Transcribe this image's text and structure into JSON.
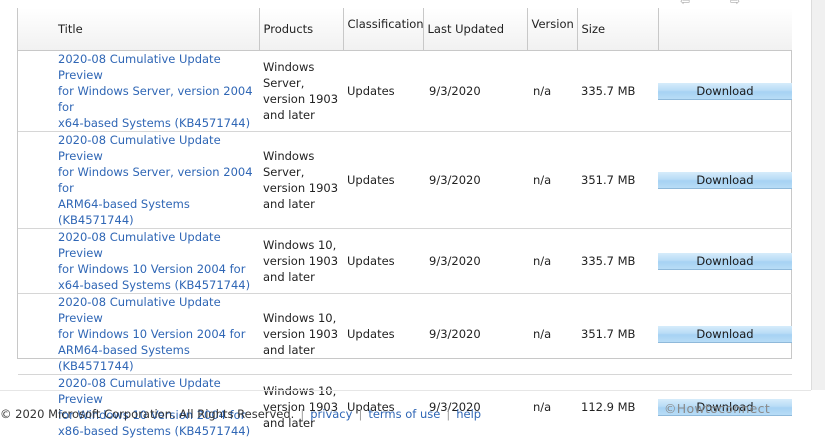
{
  "table": {
    "headers": {
      "title": "Title",
      "products": "Products",
      "classification": "Classification",
      "last_updated": "Last Updated",
      "version": "Version",
      "size": "Size"
    },
    "rows": [
      {
        "title": [
          "2020-08 Cumulative Update Preview",
          "for Windows Server, version 2004 for",
          "x64-based Systems (KB4571744)"
        ],
        "products": [
          "Windows",
          "Server,",
          "version 1903",
          "and later"
        ],
        "classification": "Updates",
        "last_updated": "9/3/2020",
        "version": "n/a",
        "size": "335.7 MB",
        "download": "Download"
      },
      {
        "title": [
          "2020-08 Cumulative Update Preview",
          "for Windows Server, version 2004 for",
          "ARM64-based Systems (KB4571744)"
        ],
        "products": [
          "Windows",
          "Server,",
          "version 1903",
          "and later"
        ],
        "classification": "Updates",
        "last_updated": "9/3/2020",
        "version": "n/a",
        "size": "351.7 MB",
        "download": "Download"
      },
      {
        "title": [
          "2020-08 Cumulative Update Preview",
          "for Windows 10 Version 2004 for",
          "x64-based Systems (KB4571744)"
        ],
        "products": [
          "Windows 10,",
          "version 1903",
          "and later"
        ],
        "classification": "Updates",
        "last_updated": "9/3/2020",
        "version": "n/a",
        "size": "335.7 MB",
        "download": "Download"
      },
      {
        "title": [
          "2020-08 Cumulative Update Preview",
          "for Windows 10 Version 2004 for",
          "ARM64-based Systems (KB4571744)"
        ],
        "products": [
          "Windows 10,",
          "version 1903",
          "and later"
        ],
        "classification": "Updates",
        "last_updated": "9/3/2020",
        "version": "n/a",
        "size": "351.7 MB",
        "download": "Download"
      },
      {
        "title": [
          "2020-08 Cumulative Update Preview",
          "for Windows 10 Version 2004 for",
          "x86-based Systems (KB4571744)"
        ],
        "products": [
          "Windows 10,",
          "version 1903",
          "and later"
        ],
        "classification": "Updates",
        "last_updated": "9/3/2020",
        "version": "n/a",
        "size": "112.9 MB",
        "download": "Download"
      }
    ]
  },
  "footer": {
    "copyright": "© 2020 Microsoft Corporation. All Rights Reserved.",
    "links": [
      "privacy",
      "terms of use",
      "help"
    ],
    "separator": "|"
  },
  "watermark": "©Howtoconnect",
  "colors": {
    "link": "#2f66b5",
    "download_button": "#b9dcf6"
  }
}
